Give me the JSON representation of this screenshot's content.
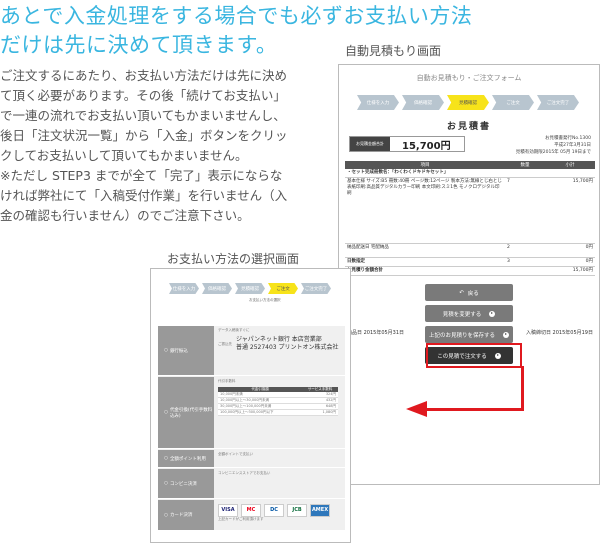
{
  "headline": [
    "あとで入金処理をする場合でも必ずお支払い方法",
    "だけは先に決めて頂きます。"
  ],
  "body": "ご注文するにあたり、お支払い方法だけは先に決め\nて頂く必要があります。その後「続けてお支払い」\nで一連の流れでお支払い頂いてもかまいませんし、\n後日「注文状況一覧」から「入金」ボタンをクリッ\nクしてお支払いして頂いてもかまいません。\n※ただし STEP3 までが全て「完了」表示にならな\nければ弊社にて「入稿受付作業」を行いません（入\n金の確認も行いません）のでご注意下さい。",
  "captions": {
    "estimate": "自動見積もり画面",
    "payment": "お支払い方法の選択画面"
  },
  "estimate": {
    "form_title": "自動お見積もり・ご注文フォーム",
    "steps": [
      {
        "tag": "STEP1",
        "label": "仕様を入力"
      },
      {
        "tag": "STEP2",
        "label": "価格確認"
      },
      {
        "tag": "STEP3",
        "label": "見積確認"
      },
      {
        "tag": "STEP4",
        "label": "ご注文"
      },
      {
        "tag": "STEP5",
        "label": "ご注文完了"
      }
    ],
    "title": "お見積書",
    "total_label": "お見積金額合計",
    "total": "15,700円",
    "meta": [
      "お見積書発行No.1300",
      "平成27年3月31日",
      "見積有効期限2015年 05月 19日まで"
    ],
    "table_head": [
      "項目",
      "数量",
      "小計"
    ],
    "rows": [
      {
        "item": "・セット完成冊数名：「わくわくドキドキセット」",
        "qty": "",
        "sub": ""
      },
      {
        "item": "基本仕様  サイズ:B5  冊数:40冊  ページ数:12ページ  製本方法:無線とじ右とじ  表紙印刷:高品質デジタルカラー印刷  本文印刷:スミ1色 モノクロデジタル印刷",
        "qty": "7",
        "sub": "15,700円"
      },
      {
        "item": "納品配送日  宅配納品",
        "qty": "2",
        "sub": "0円"
      },
      {
        "item": "日数指定",
        "qty": "3",
        "sub": "0円"
      },
      {
        "item": "お見積り金額合計",
        "qty": "",
        "sub": "15,700円"
      }
    ],
    "dates": {
      "left": "納品日 2015年05月31日",
      "right": "入稿締切日 2015年05月19日"
    },
    "buttons": {
      "back": "戻る",
      "change": "見積を変更する",
      "save": "上記のお見積りを保存する",
      "order": "この見積で注文する"
    }
  },
  "payment": {
    "steps": [
      {
        "tag": "STEP1",
        "label": "仕様を入力"
      },
      {
        "tag": "STEP2",
        "label": "価格確認"
      },
      {
        "tag": "STEP3",
        "label": "見積確認"
      },
      {
        "tag": "STEP4",
        "label": "ご注文"
      },
      {
        "tag": "STEP5",
        "label": "ご注文完了"
      }
    ],
    "select_label": "お支払い方法の選択",
    "rows": [
      {
        "label": "銀行振込",
        "note": "データ入稿後すぐに"
      },
      {
        "label": "代金引換(代引手数料込み)",
        "note": "代引手数料"
      },
      {
        "label": "全額ポイント利用",
        "note": "全額ポイントで支払い"
      },
      {
        "label": "コンビニ決済",
        "note": "コンビニエンスストアでお支払い"
      },
      {
        "label": "カード決済",
        "note": "上記カードがご利用頂けます"
      }
    ],
    "bank": {
      "prefix": "ご振込先",
      "name": "ジャパンネット銀行 本店営業部",
      "account": "普通 2527403 プリントオン株式会社"
    },
    "fee_head": [
      "代金引換額",
      "サービス手数料"
    ],
    "fees": [
      [
        "10,000円未満",
        "324円"
      ],
      [
        "10,000円以上～30,000円未満",
        "432円"
      ],
      [
        "30,000円以上～100,000円未満",
        "648円"
      ],
      [
        "100,000円以上～300,000円以下",
        "1,080円"
      ]
    ],
    "cards": [
      "VISA",
      "MC",
      "DC",
      "JCB",
      "AMEX"
    ]
  }
}
